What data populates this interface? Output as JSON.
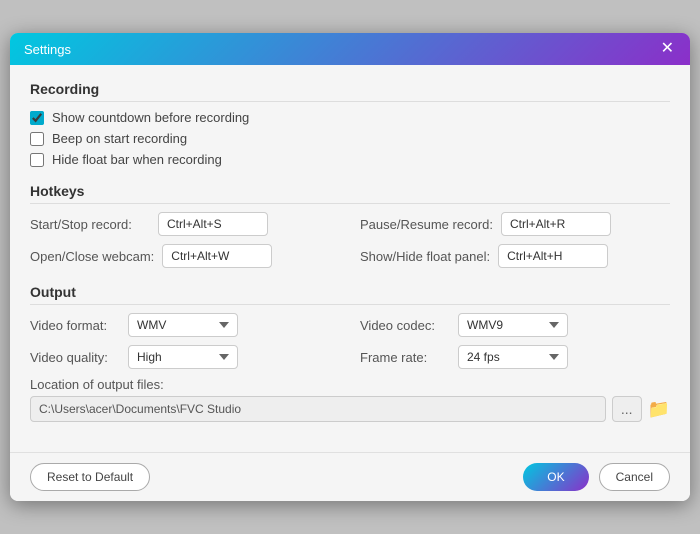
{
  "titlebar": {
    "title": "Settings",
    "close_icon": "✕"
  },
  "recording": {
    "section_title": "Recording",
    "checkbox1_label": "Show countdown before recording",
    "checkbox1_checked": true,
    "checkbox2_label": "Beep on start recording",
    "checkbox2_checked": false,
    "checkbox3_label": "Hide float bar when recording",
    "checkbox3_checked": false
  },
  "hotkeys": {
    "section_title": "Hotkeys",
    "rows": [
      {
        "label": "Start/Stop record:",
        "value": "Ctrl+Alt+S"
      },
      {
        "label": "Pause/Resume record:",
        "value": "Ctrl+Alt+R"
      },
      {
        "label": "Open/Close webcam:",
        "value": "Ctrl+Alt+W"
      },
      {
        "label": "Show/Hide float panel:",
        "value": "Ctrl+Alt+H"
      }
    ]
  },
  "output": {
    "section_title": "Output",
    "video_format_label": "Video format:",
    "video_format_value": "WMV",
    "video_codec_label": "Video codec:",
    "video_codec_value": "WMV9",
    "video_quality_label": "Video quality:",
    "video_quality_value": "High",
    "frame_rate_label": "Frame rate:",
    "frame_rate_value": "24 fps",
    "location_label": "Location of output files:",
    "location_value": "C:\\Users\\acer\\Documents\\FVC Studio",
    "browse_label": "...",
    "folder_icon": "📁"
  },
  "footer": {
    "reset_label": "Reset to Default",
    "ok_label": "OK",
    "cancel_label": "Cancel"
  }
}
